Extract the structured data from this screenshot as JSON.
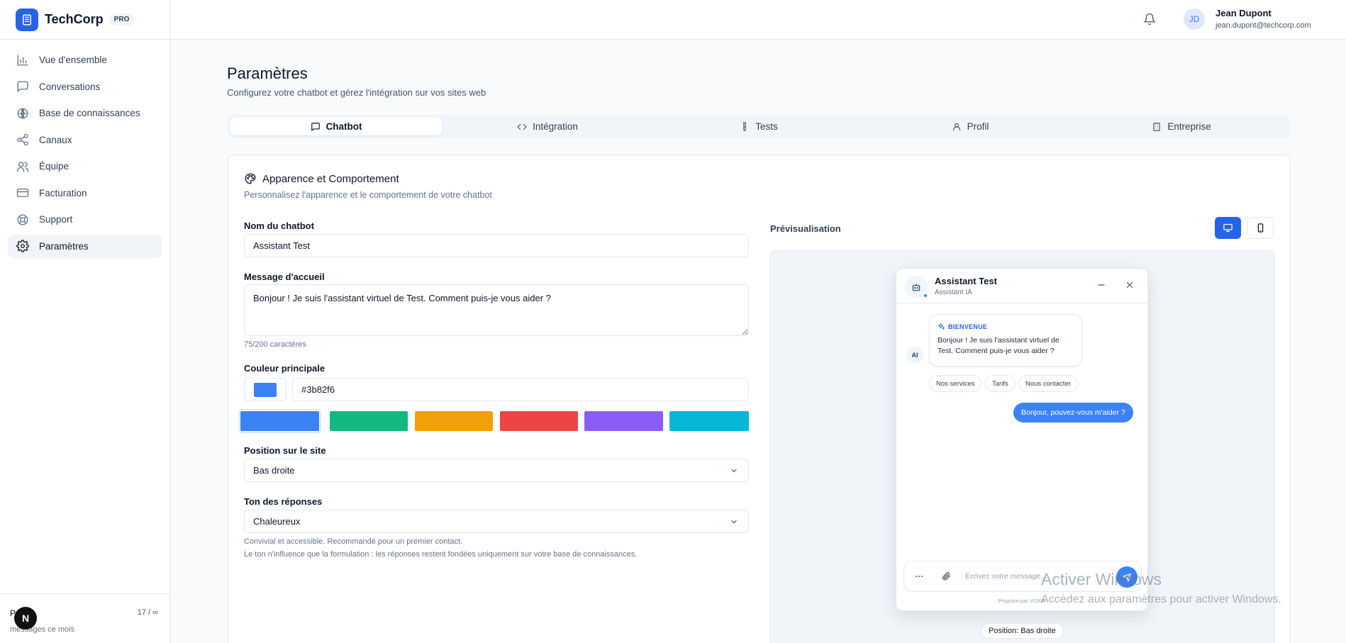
{
  "brand": {
    "name": "TechCorp",
    "badge": "PRO"
  },
  "sidebar": {
    "items": [
      {
        "label": "Vue d'ensemble",
        "icon": "bar-chart-icon"
      },
      {
        "label": "Conversations",
        "icon": "message-square-icon"
      },
      {
        "label": "Base de connaissances",
        "icon": "brain-icon"
      },
      {
        "label": "Canaux",
        "icon": "share-icon"
      },
      {
        "label": "Équipe",
        "icon": "users-icon"
      },
      {
        "label": "Facturation",
        "icon": "credit-card-icon"
      },
      {
        "label": "Support",
        "icon": "life-buoy-icon"
      },
      {
        "label": "Paramètres",
        "icon": "settings-icon",
        "active": true
      }
    ],
    "usage": {
      "label": "P",
      "count": "17 / ∞",
      "sub": "messages ce mois",
      "overlay_badge": "N"
    }
  },
  "topbar": {
    "user": {
      "initials": "JD",
      "name": "Jean Dupont",
      "email": "jean.dupont@techcorp.com"
    }
  },
  "page": {
    "title": "Paramètres",
    "subtitle": "Configurez votre chatbot et gérez l'intégration sur vos sites web"
  },
  "tabs": [
    {
      "label": "Chatbot",
      "icon": "message-square-icon",
      "active": true
    },
    {
      "label": "Intégration",
      "icon": "code-icon"
    },
    {
      "label": "Tests",
      "icon": "test-tube-icon"
    },
    {
      "label": "Profil",
      "icon": "user-icon"
    },
    {
      "label": "Entreprise",
      "icon": "building-icon"
    }
  ],
  "card": {
    "title": "Apparence et Comportement",
    "subtitle": "Personnalisez l'apparence et le comportement de votre chatbot"
  },
  "form": {
    "name_label": "Nom du chatbot",
    "name_value": "Assistant Test",
    "welcome_label": "Message d'accueil",
    "welcome_value": "Bonjour ! Je suis l'assistant virtuel de Test. Comment puis-je vous aider ?",
    "welcome_count": "75/200 caractères",
    "color_label": "Couleur principale",
    "color_value": "#3b82f6",
    "palette": [
      "#3b82f6",
      "#10b981",
      "#f59e0b",
      "#ef4444",
      "#8b5cf6",
      "#06b6d4"
    ],
    "position_label": "Position sur le site",
    "position_value": "Bas droite",
    "tone_label": "Ton des réponses",
    "tone_value": "Chaleureux",
    "tone_hint1": "Convivial et accessible. Recommandé pour un premier contact.",
    "tone_hint2": "Le ton n'influence que la formulation : les réponses restent fondées uniquement sur votre base de connaissances."
  },
  "preview": {
    "label": "Prévisualisation",
    "active_device": "desktop",
    "widget": {
      "title": "Assistant Test",
      "subtitle": "Assistant IA",
      "ai_badge": "AI",
      "welcome_tag": "BIENVENUE",
      "bot_message": "Bonjour ! Je suis l'assistant virtuel de Test. Comment puis-je vous aider ?",
      "chips": [
        "Nos services",
        "Tarifs",
        "Nous contacter"
      ],
      "user_message": "Bonjour, pouvez-vous m'aider ?",
      "input_placeholder": "Écrivez votre message...",
      "powered_by": "Propulsé par VOXIA"
    },
    "position_pill": "Position: Bas droite"
  },
  "watermark": {
    "line1": "Activer Windows",
    "line2": "Accédez aux paramètres pour activer Windows."
  },
  "colors": {
    "primary": "#3b82f6",
    "brand": "#2563eb"
  }
}
